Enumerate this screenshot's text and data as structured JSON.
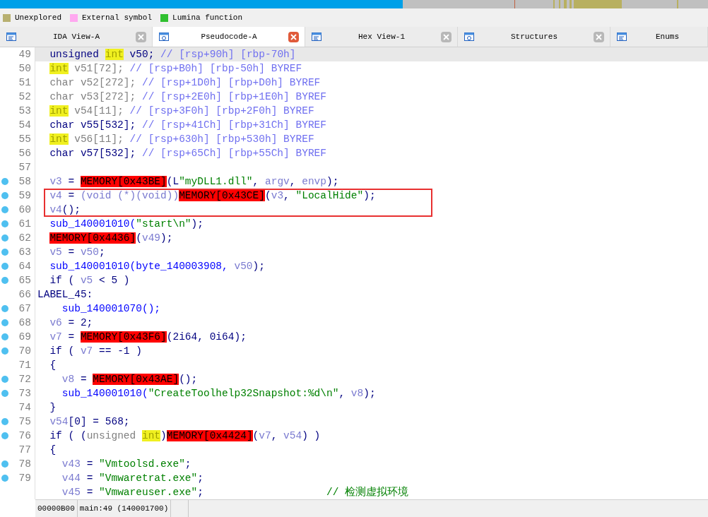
{
  "legend": [
    {
      "label": "Unexplored",
      "color": "#b8b070"
    },
    {
      "label": "External symbol",
      "color": "#ffa8f0"
    },
    {
      "label": "Lumina function",
      "color": "#30c030"
    }
  ],
  "tabs": [
    {
      "label": "IDA View-A",
      "selected": false,
      "closable": true
    },
    {
      "label": "Pseudocode-A",
      "selected": true,
      "closable": true
    },
    {
      "label": "Hex View-1",
      "selected": false,
      "closable": true
    },
    {
      "label": "Structures",
      "selected": false,
      "closable": true
    },
    {
      "label": "Enums",
      "selected": false,
      "closable": false
    }
  ],
  "code_lines": [
    {
      "number": "49",
      "breakpoint": false,
      "current": true,
      "framed": false,
      "tokens": [
        {
          "text": "  unsigned ",
          "kind": "plain"
        },
        {
          "text": "int",
          "kind": "keyword"
        },
        {
          "text": " v50; ",
          "kind": "plain"
        },
        {
          "text": "// [rsp+90h] [rbp-70h]",
          "kind": "comment"
        }
      ]
    },
    {
      "number": "50",
      "breakpoint": false,
      "current": false,
      "framed": false,
      "tokens": [
        {
          "text": "  int",
          "kind": "keyword"
        },
        {
          "text": " v51[72]; ",
          "kind": "type"
        },
        {
          "text": "// [rsp+B0h] [rbp-50h] BYREF",
          "kind": "comment"
        }
      ]
    },
    {
      "number": "51",
      "breakpoint": false,
      "current": false,
      "framed": false,
      "tokens": [
        {
          "text": "  char v52[272]; ",
          "kind": "type"
        },
        {
          "text": "// [rsp+1D0h] [rbp+D0h] BYREF",
          "kind": "comment"
        }
      ]
    },
    {
      "number": "52",
      "breakpoint": false,
      "current": false,
      "framed": false,
      "tokens": [
        {
          "text": "  char v53[272]; ",
          "kind": "type"
        },
        {
          "text": "// [rsp+2E0h] [rbp+1E0h] BYREF",
          "kind": "comment"
        }
      ]
    },
    {
      "number": "53",
      "breakpoint": false,
      "current": false,
      "framed": false,
      "tokens": [
        {
          "text": "  int",
          "kind": "keyword"
        },
        {
          "text": " v54[11]; ",
          "kind": "type"
        },
        {
          "text": "// [rsp+3F0h] [rbp+2F0h] BYREF",
          "kind": "comment"
        }
      ]
    },
    {
      "number": "54",
      "breakpoint": false,
      "current": false,
      "framed": false,
      "tokens": [
        {
          "text": "  char v55[532]; ",
          "kind": "plain"
        },
        {
          "text": "// [rsp+41Ch] [rbp+31Ch] BYREF",
          "kind": "comment"
        }
      ]
    },
    {
      "number": "55",
      "breakpoint": false,
      "current": false,
      "framed": false,
      "tokens": [
        {
          "text": "  int",
          "kind": "keyword"
        },
        {
          "text": " v56[11]; ",
          "kind": "type"
        },
        {
          "text": "// [rsp+630h] [rbp+530h] BYREF",
          "kind": "comment"
        }
      ]
    },
    {
      "number": "56",
      "breakpoint": false,
      "current": false,
      "framed": false,
      "tokens": [
        {
          "text": "  char v57[532]; ",
          "kind": "plain"
        },
        {
          "text": "// [rsp+65Ch] [rbp+55Ch] BYREF",
          "kind": "comment"
        }
      ]
    },
    {
      "number": "57",
      "breakpoint": false,
      "current": false,
      "framed": false
    },
    {
      "number": "58",
      "breakpoint": true,
      "current": false,
      "framed": false,
      "tokens": [
        {
          "text": "  v3",
          "kind": "variable"
        },
        {
          "text": " = ",
          "kind": "plain"
        },
        {
          "text": "MEMORY[0x43BE]",
          "kind": "memory"
        },
        {
          "text": "(L",
          "kind": "plain"
        },
        {
          "text": "\"myDLL1.dll\"",
          "kind": "string"
        },
        {
          "text": ", ",
          "kind": "plain"
        },
        {
          "text": "argv",
          "kind": "variable"
        },
        {
          "text": ", ",
          "kind": "plain"
        },
        {
          "text": "envp",
          "kind": "variable"
        },
        {
          "text": ");",
          "kind": "plain"
        }
      ]
    },
    {
      "number": "59",
      "breakpoint": true,
      "current": false,
      "framed": true,
      "tokens": [
        {
          "text": "  v4",
          "kind": "variable"
        },
        {
          "text": " = ",
          "kind": "plain"
        },
        {
          "text": "(void (*)(void))",
          "kind": "variable"
        },
        {
          "text": "MEMORY[0x43CE]",
          "kind": "memory"
        },
        {
          "text": "(",
          "kind": "plain"
        },
        {
          "text": "v3",
          "kind": "variable"
        },
        {
          "text": ", ",
          "kind": "plain"
        },
        {
          "text": "\"LocalHide\"",
          "kind": "string"
        },
        {
          "text": ");",
          "kind": "plain"
        }
      ]
    },
    {
      "number": "60",
      "breakpoint": true,
      "current": false,
      "framed": true,
      "tokens": [
        {
          "text": "  v4",
          "kind": "variable"
        },
        {
          "text": "();",
          "kind": "plain"
        }
      ]
    },
    {
      "number": "61",
      "breakpoint": true,
      "current": false,
      "framed": false,
      "tokens": [
        {
          "text": "  sub_140001010(",
          "kind": "function"
        },
        {
          "text": "\"start\\n\"",
          "kind": "string"
        },
        {
          "text": ");",
          "kind": "plain"
        }
      ]
    },
    {
      "number": "62",
      "breakpoint": true,
      "current": false,
      "framed": false,
      "tokens": [
        {
          "text": "  MEMORY[0x4436]",
          "kind": "memory"
        },
        {
          "text": "(",
          "kind": "plain"
        },
        {
          "text": "v49",
          "kind": "variable"
        },
        {
          "text": ");",
          "kind": "plain"
        }
      ]
    },
    {
      "number": "63",
      "breakpoint": true,
      "current": false,
      "framed": false,
      "tokens": [
        {
          "text": "  v5",
          "kind": "variable"
        },
        {
          "text": " = ",
          "kind": "plain"
        },
        {
          "text": "v50",
          "kind": "variable"
        },
        {
          "text": ";",
          "kind": "plain"
        }
      ]
    },
    {
      "number": "64",
      "breakpoint": true,
      "current": false,
      "framed": false,
      "tokens": [
        {
          "text": "  sub_140001010(byte_140003908, ",
          "kind": "function"
        },
        {
          "text": "v50",
          "kind": "variable"
        },
        {
          "text": ");",
          "kind": "plain"
        }
      ]
    },
    {
      "number": "65",
      "breakpoint": true,
      "current": false,
      "framed": false,
      "tokens": [
        {
          "text": "  if ( ",
          "kind": "plain"
        },
        {
          "text": "v5",
          "kind": "variable"
        },
        {
          "text": " < 5 )",
          "kind": "plain"
        }
      ]
    },
    {
      "number": "66",
      "breakpoint": false,
      "current": false,
      "framed": false,
      "tokens": [
        {
          "text": "LABEL_45:",
          "kind": "plain"
        }
      ]
    },
    {
      "number": "67",
      "breakpoint": true,
      "current": false,
      "framed": false,
      "tokens": [
        {
          "text": "    sub_140001070();",
          "kind": "function"
        }
      ]
    },
    {
      "number": "68",
      "breakpoint": true,
      "current": false,
      "framed": false,
      "tokens": [
        {
          "text": "  v6",
          "kind": "variable"
        },
        {
          "text": " = 2;",
          "kind": "plain"
        }
      ]
    },
    {
      "number": "69",
      "breakpoint": true,
      "current": false,
      "framed": false,
      "tokens": [
        {
          "text": "  v7",
          "kind": "variable"
        },
        {
          "text": " = ",
          "kind": "plain"
        },
        {
          "text": "MEMORY[0x43F6]",
          "kind": "memory"
        },
        {
          "text": "(2i64, 0i64);",
          "kind": "plain"
        }
      ]
    },
    {
      "number": "70",
      "breakpoint": true,
      "current": false,
      "framed": false,
      "tokens": [
        {
          "text": "  if ( ",
          "kind": "plain"
        },
        {
          "text": "v7",
          "kind": "variable"
        },
        {
          "text": " == -1 )",
          "kind": "plain"
        }
      ]
    },
    {
      "number": "71",
      "breakpoint": false,
      "current": false,
      "framed": false,
      "tokens": [
        {
          "text": "  {",
          "kind": "plain"
        }
      ]
    },
    {
      "number": "72",
      "breakpoint": true,
      "current": false,
      "framed": false,
      "tokens": [
        {
          "text": "    v8",
          "kind": "variable"
        },
        {
          "text": " = ",
          "kind": "plain"
        },
        {
          "text": "MEMORY[0x43AE]",
          "kind": "memory"
        },
        {
          "text": "();",
          "kind": "plain"
        }
      ]
    },
    {
      "number": "73",
      "breakpoint": true,
      "current": false,
      "framed": false,
      "tokens": [
        {
          "text": "    sub_140001010(",
          "kind": "function"
        },
        {
          "text": "\"CreateToolhelp32Snapshot:%d\\n\"",
          "kind": "string"
        },
        {
          "text": ", ",
          "kind": "plain"
        },
        {
          "text": "v8",
          "kind": "variable"
        },
        {
          "text": ");",
          "kind": "plain"
        }
      ]
    },
    {
      "number": "74",
      "breakpoint": false,
      "current": false,
      "framed": false,
      "tokens": [
        {
          "text": "  }",
          "kind": "plain"
        }
      ]
    },
    {
      "number": "75",
      "breakpoint": true,
      "current": false,
      "framed": false,
      "tokens": [
        {
          "text": "  v54",
          "kind": "variable"
        },
        {
          "text": "[0] = 568;",
          "kind": "plain"
        }
      ]
    },
    {
      "number": "76",
      "breakpoint": true,
      "current": false,
      "framed": false,
      "tokens": [
        {
          "text": "  if ( (",
          "kind": "plain"
        },
        {
          "text": "unsigned ",
          "kind": "type"
        },
        {
          "text": "int",
          "kind": "keyword"
        },
        {
          "text": ")",
          "kind": "plain"
        },
        {
          "text": "MEMORY[0x4424]",
          "kind": "memory"
        },
        {
          "text": "(",
          "kind": "plain"
        },
        {
          "text": "v7",
          "kind": "variable"
        },
        {
          "text": ", ",
          "kind": "plain"
        },
        {
          "text": "v54",
          "kind": "variable"
        },
        {
          "text": ") )",
          "kind": "plain"
        }
      ]
    },
    {
      "number": "77",
      "breakpoint": false,
      "current": false,
      "framed": false,
      "tokens": [
        {
          "text": "  {",
          "kind": "plain"
        }
      ]
    },
    {
      "number": "78",
      "breakpoint": true,
      "current": false,
      "framed": false,
      "tokens": [
        {
          "text": "    v43",
          "kind": "variable"
        },
        {
          "text": " = ",
          "kind": "plain"
        },
        {
          "text": "\"Vmtoolsd.exe\"",
          "kind": "string"
        },
        {
          "text": ";",
          "kind": "plain"
        }
      ]
    },
    {
      "number": "79",
      "breakpoint": true,
      "current": false,
      "framed": false,
      "tokens": [
        {
          "text": "    v44",
          "kind": "variable"
        },
        {
          "text": " = ",
          "kind": "plain"
        },
        {
          "text": "\"Vmwaretrat.exe\"",
          "kind": "string"
        },
        {
          "text": ";",
          "kind": "plain"
        }
      ]
    },
    {
      "breakpoint": false,
      "current": false,
      "framed": false,
      "tokens": [
        {
          "text": "    v45",
          "kind": "variable"
        },
        {
          "text": " = ",
          "kind": "plain"
        },
        {
          "text": "\"Vmwareuser.exe\"",
          "kind": "string"
        },
        {
          "text": ";                    ",
          "kind": "plain"
        },
        {
          "text": "// 检测虚拟环境",
          "kind": "string"
        }
      ]
    }
  ],
  "status_bar": [
    "00000B00",
    "main:49 (140001700)"
  ]
}
